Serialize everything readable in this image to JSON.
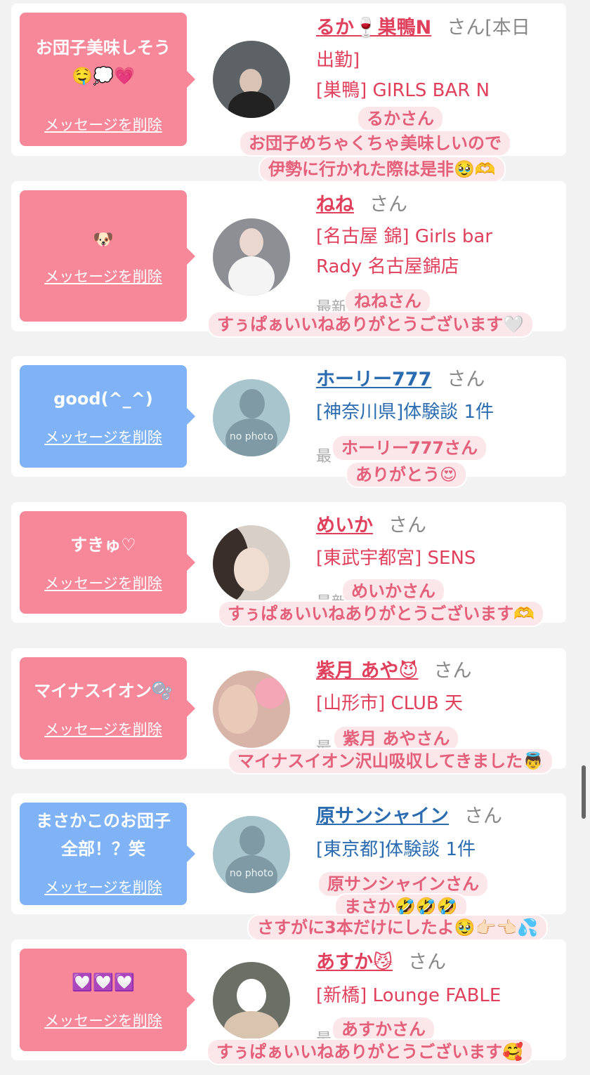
{
  "delete_label": "メッセージを削除",
  "san_label": "さん",
  "colors": {
    "pink": "#f6889a",
    "blue": "#7fb3f5",
    "name_pink": "#e0405c",
    "name_blue": "#2b6cb0",
    "sticker_bg": "#fbe6ea",
    "sticker_text": "#e4607a"
  },
  "cards": [
    {
      "message": "お団子美味しそう",
      "message2": "🤤💭💗",
      "name": "るか🍷巣鴨N",
      "san_suffix": "さん[本日",
      "info1": "出勤]",
      "info2": "[巣鴨] GIRLS BAR N",
      "stickers": [
        "るかさん",
        "お団子めちゃくちゃ美味しいので",
        "伊勢に行かれた際は是非🥹🫶"
      ]
    },
    {
      "message": "🐶",
      "name": "ねね",
      "info1": "[名古屋 錦] Girls bar",
      "info2": "Rady 名古屋錦店",
      "faded": "最新",
      "stickers": [
        "ねねさん",
        "すぅぱぁいいねありがとうございます🤍"
      ]
    },
    {
      "message": "good(^_^)",
      "name": "ホーリー777",
      "info1": "[神奈川県]体験談 1件",
      "faded": "最",
      "avatar_label": "no photo",
      "stickers": [
        "ホーリー777さん",
        "ありがとう😍"
      ]
    },
    {
      "message": "すきゅ♡",
      "name": "めいか",
      "info1": "[東武宇都宮] SENS",
      "faded": "最新",
      "stickers": [
        "めいかさん",
        "すぅぱぁいいねありがとうございます🫶"
      ]
    },
    {
      "message": "マイナスイオン🫧",
      "name": "紫月 あや😈",
      "info1": "[山形市] CLUB 天",
      "faded": "最",
      "stickers": [
        "紫月 あやさん",
        "マイナスイオン沢山吸収してきました👼"
      ]
    },
    {
      "message": "まさかこのお団子",
      "message2": "全部！？笑",
      "name": "原サンシャイン",
      "info1": "[東京都]体験談 1件",
      "avatar_label": "no photo",
      "stickers": [
        "原サンシャインさん",
        "まさか🤣🤣🤣",
        "さすがに3本だけにしたよ🥹👉🏻👈🏻💦"
      ]
    },
    {
      "message": "💟💟💟",
      "name": "あすか😼",
      "info1": "[新橋] Lounge FABLE",
      "faded": "最",
      "stickers": [
        "あすかさん",
        "すぅぱぁいいねありがとうございます🥰"
      ]
    }
  ]
}
